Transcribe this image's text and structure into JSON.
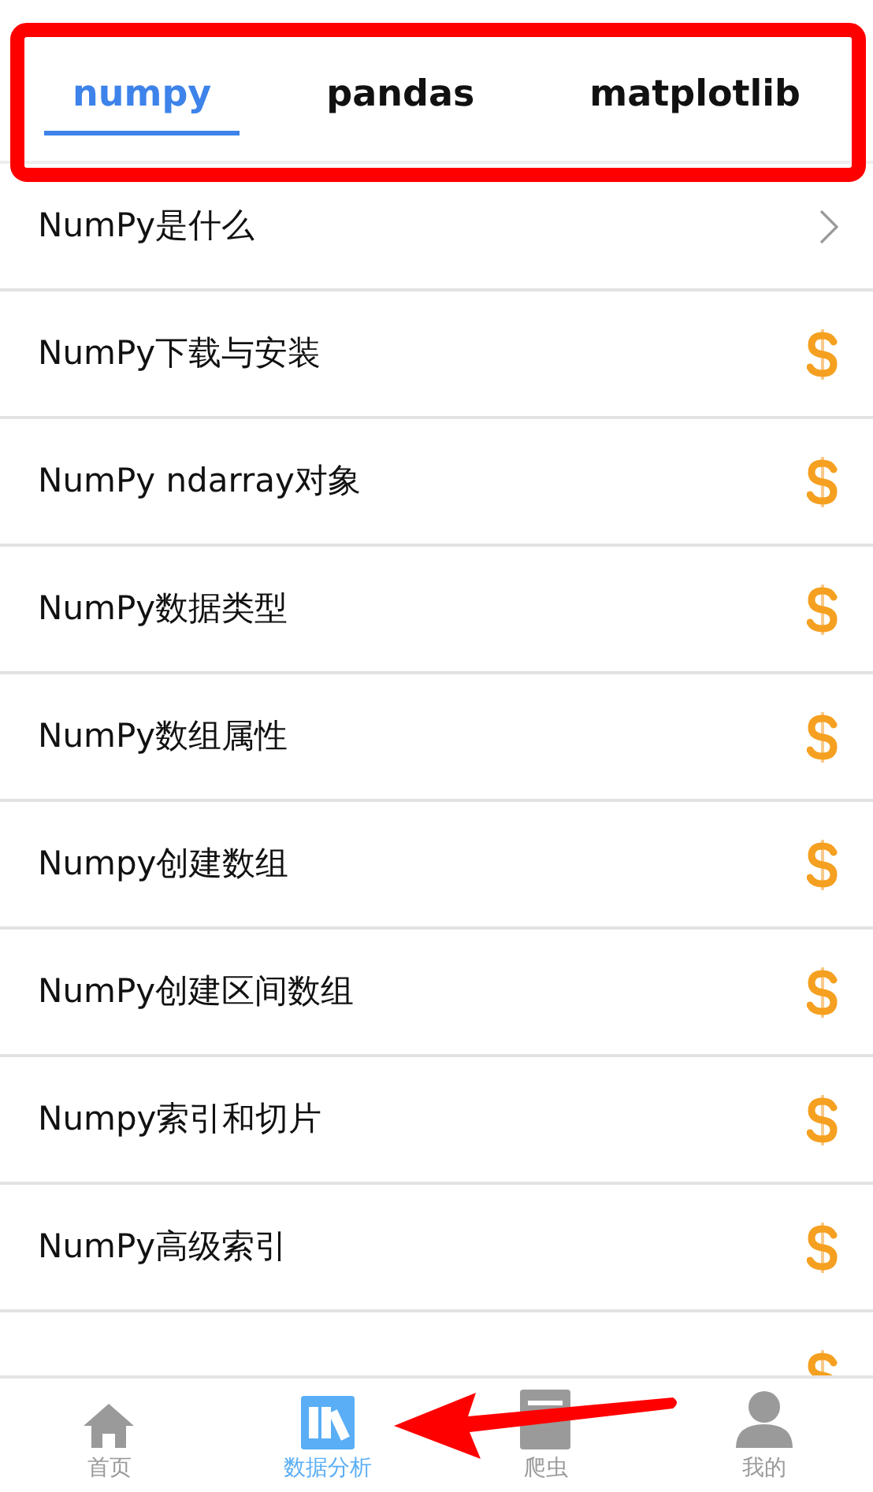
{
  "tabs": [
    {
      "label": "numpy",
      "selected": true
    },
    {
      "label": "pandas",
      "selected": false
    },
    {
      "label": "matplotlib",
      "selected": false
    }
  ],
  "lessons": [
    {
      "title": "NumPy是什么",
      "kind": "chevron"
    },
    {
      "title": "NumPy下载与安装",
      "kind": "paid"
    },
    {
      "title": "NumPy ndarray对象",
      "kind": "paid"
    },
    {
      "title": "NumPy数据类型",
      "kind": "paid"
    },
    {
      "title": "NumPy数组属性",
      "kind": "paid"
    },
    {
      "title": "Numpy创建数组",
      "kind": "paid"
    },
    {
      "title": "NumPy创建区间数组",
      "kind": "paid"
    },
    {
      "title": "Numpy索引和切片",
      "kind": "paid"
    },
    {
      "title": "NumPy高级索引",
      "kind": "paid"
    },
    {
      "kind": "paid"
    }
  ],
  "bottom_nav": [
    {
      "label": "首页",
      "kind": "home",
      "selected": false
    },
    {
      "label": "数据分析",
      "kind": "books",
      "selected": true
    },
    {
      "label": "爬虫",
      "kind": "book",
      "selected": false
    },
    {
      "label": "我的",
      "kind": "person",
      "selected": false
    }
  ],
  "annotations": {
    "highlight_box": true,
    "arrow": true
  }
}
